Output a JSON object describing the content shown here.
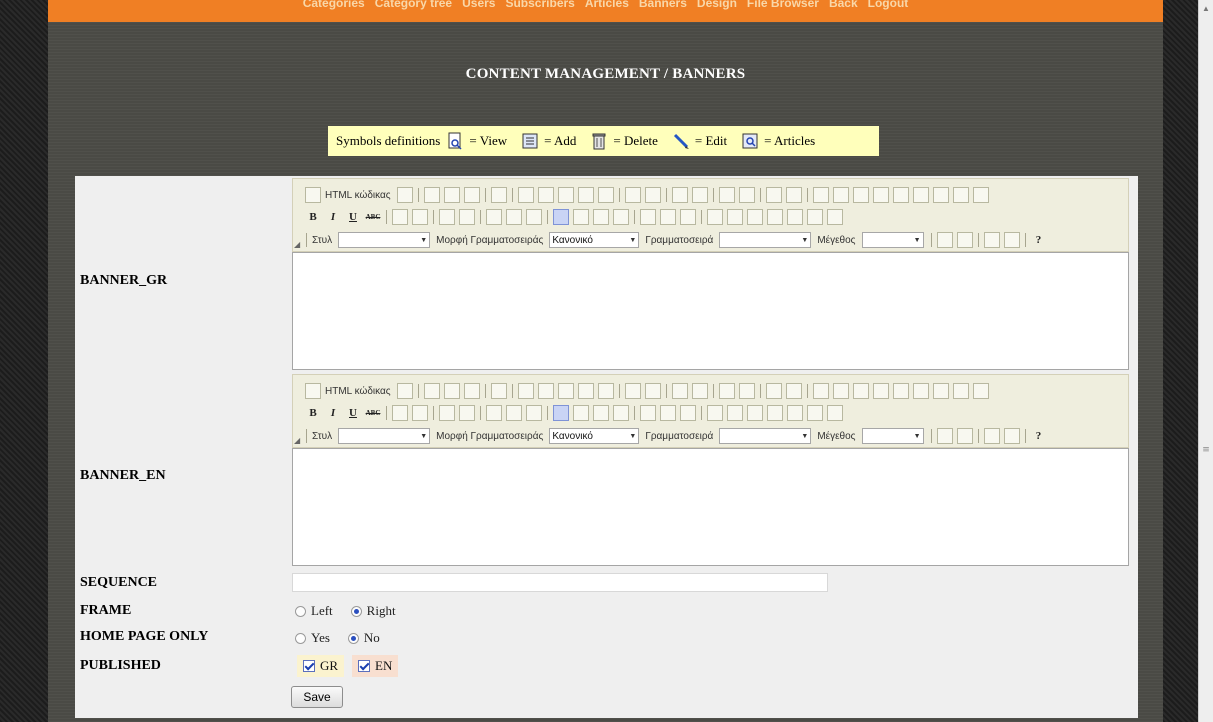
{
  "nav": {
    "items": [
      "Categories",
      "Category tree",
      "Users",
      "Subscribers",
      "Articles",
      "Banners",
      "Design",
      "File Browser",
      "Back",
      "Logout"
    ]
  },
  "page": {
    "title": "CONTENT MANAGEMENT / BANNERS"
  },
  "symbols": {
    "prefix": "Symbols definitions",
    "view": "= View",
    "add": "= Add",
    "delete": "= Delete",
    "edit": "= Edit",
    "articles": "= Articles"
  },
  "editor_toolbar": {
    "html_code": "HTML κώδικας",
    "style_label": "Στυλ",
    "format_label": "Μορφή Γραμματοσειράς",
    "format_value": "Κανονικό",
    "font_label": "Γραμματοσειρά",
    "size_label": "Μέγεθος",
    "bold": "B",
    "italic": "I",
    "underline": "U",
    "strike": "ABC",
    "help": "?"
  },
  "form": {
    "banner_gr_label": "BANNER_GR",
    "banner_en_label": "BANNER_EN",
    "sequence_label": "SEQUENCE",
    "sequence_value": "",
    "frame_label": "FRAME",
    "frame_options": [
      "Left",
      "Right"
    ],
    "frame_selected": "Right",
    "homepage_label": "HOME PAGE ONLY",
    "homepage_options": [
      "Yes",
      "No"
    ],
    "homepage_selected": "No",
    "published_label": "PUBLISHED",
    "published_gr": "GR",
    "published_en": "EN",
    "save_label": "Save"
  },
  "colors": {
    "nav_bar": "#f07f24",
    "nav_text": "#f9d7a8",
    "symbols_bg": "#ffffbb",
    "form_bg": "#efefef",
    "toolbar_bg": "#efeede"
  }
}
